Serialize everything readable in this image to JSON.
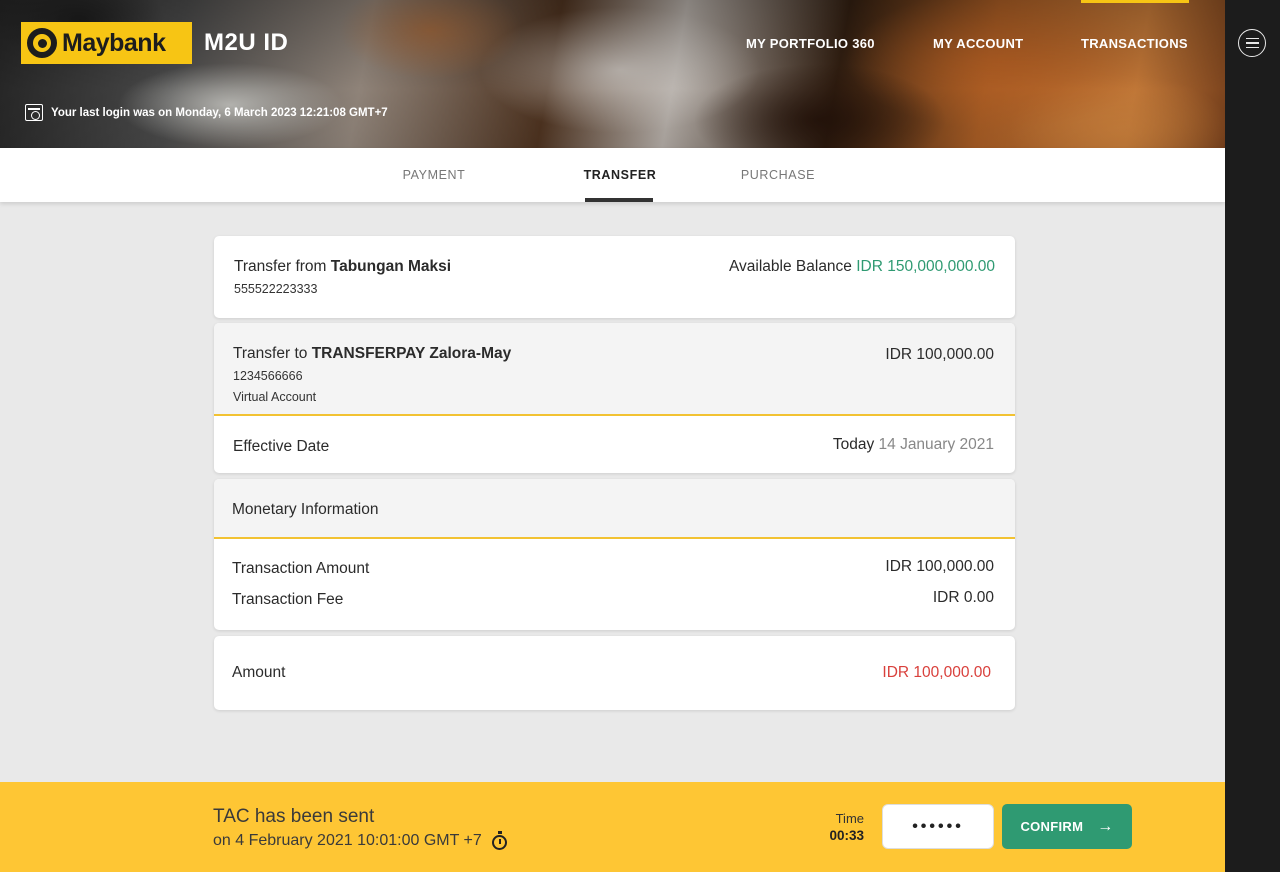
{
  "header": {
    "logo_text": "Maybank",
    "app_title": "M2U ID",
    "nav": [
      "MY PORTFOLIO 360",
      "MY ACCOUNT",
      "TRANSACTIONS"
    ],
    "last_login": "Your last login was on Monday, 6 March 2023 12:21:08 GMT+7"
  },
  "tabs": [
    "PAYMENT",
    "TRANSFER",
    "PURCHASE"
  ],
  "transfer_from": {
    "prefix": "Transfer from",
    "account_name": "Tabungan Maksi",
    "account_number": "555522223333",
    "balance_label": "Available Balance",
    "balance_value": "IDR 150,000,000.00"
  },
  "transfer_to": {
    "prefix": "Transfer to",
    "payee_name": "TRANSFERPAY Zalora-May",
    "account_number": "1234566666",
    "account_type": "Virtual Account",
    "amount": "IDR 100,000.00"
  },
  "effective_date": {
    "label": "Effective Date",
    "today": "Today",
    "date": "14 January 2021"
  },
  "monetary": {
    "title": "Monetary Information",
    "transaction_amount_label": "Transaction Amount",
    "transaction_amount_value": "IDR 100,000.00",
    "transaction_fee_label": "Transaction Fee",
    "transaction_fee_value": "IDR 0.00"
  },
  "total": {
    "label": "Amount",
    "value": "IDR 100,000.00"
  },
  "tac": {
    "title": "TAC has been sent",
    "sent_on": "on 4 February 2021 10:01:00 GMT +7",
    "time_label": "Time",
    "time_value": "00:33",
    "input_value": "••••••",
    "confirm_label": "CONFIRM"
  },
  "colors": {
    "brand_yellow": "#f7c514",
    "tac_bar": "#fec634",
    "confirm_green": "#2f9a72",
    "balance_green": "#2f9a72",
    "amount_red": "#d9403c"
  }
}
